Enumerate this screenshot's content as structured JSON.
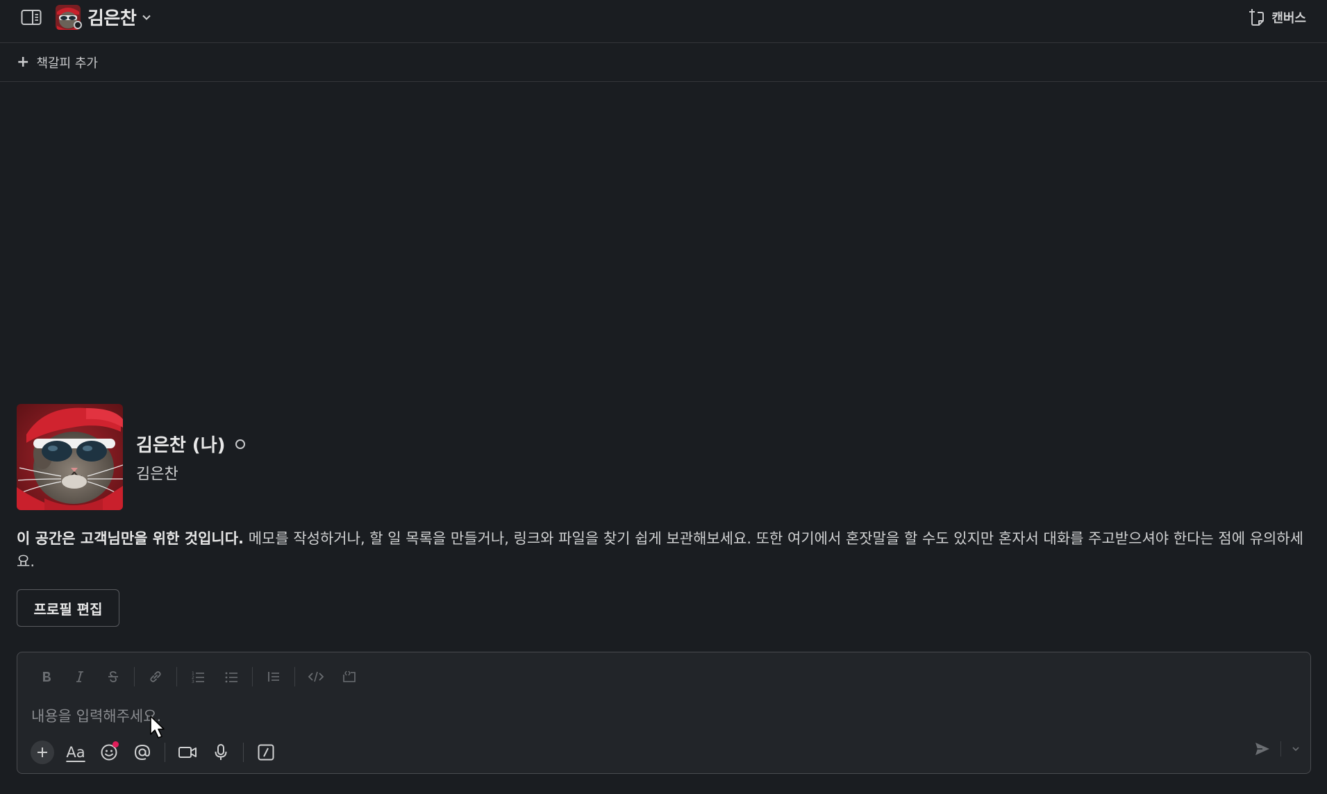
{
  "header": {
    "channel_name": "김은찬",
    "canvas_label": "캔버스"
  },
  "bookmarks": {
    "add_label": "책갈피 추가"
  },
  "profile": {
    "display_name": "김은찬 (나)",
    "username": "김은찬",
    "intro_bold": "이 공간은 고객님만을 위한 것입니다.",
    "intro_rest": " 메모를 작성하거나, 할 일 목록을 만들거나, 링크와 파일을 찾기 쉽게 보관해보세요. 또한 여기에서 혼잣말을 할 수도 있지만 혼자서 대화를 주고받으셔야 한다는 점에 유의하세요.",
    "edit_button": "프로필 편집"
  },
  "composer": {
    "placeholder": "내용을 입력해주세요.",
    "value": "",
    "format_icons": [
      "bold-icon",
      "italic-icon",
      "strikethrough-icon",
      "link-icon",
      "ordered-list-icon",
      "bulleted-list-icon",
      "blockquote-icon",
      "code-icon",
      "code-block-icon"
    ],
    "action_icons": [
      "plus-icon",
      "text-format-icon",
      "emoji-icon",
      "mention-icon",
      "video-icon",
      "microphone-icon",
      "slash-command-icon"
    ],
    "text_format_label": "Aa"
  },
  "colors": {
    "background": "#1a1d21",
    "composer_background": "#222529",
    "border": "#34363a",
    "text": "#d1d2d3",
    "notification_dot": "#e01e5a"
  }
}
